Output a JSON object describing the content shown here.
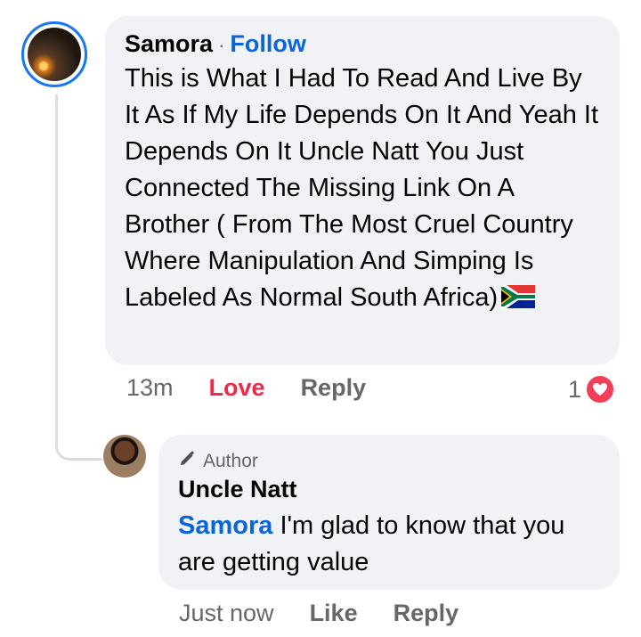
{
  "comment": {
    "author": "Samora",
    "separator": "·",
    "follow_label": "Follow",
    "text": "This is What I Had To Read And Live By It As If My Life Depends On It And Yeah It Depends On It Uncle Natt You Just Connected The Missing Link On A Brother ( From The Most Cruel Country Where Manipulation And Simping Is Labeled As Normal South Africa)",
    "flag_icon": "south-africa-flag-icon",
    "time": "13m",
    "love_label": "Love",
    "reply_label": "Reply",
    "reaction_count": "1",
    "reaction_icon": "heart-icon"
  },
  "reply": {
    "badge_label": "Author",
    "badge_icon": "pencil-icon",
    "author": "Uncle Natt",
    "mention": "Samora",
    "text": "I'm glad to know that you are getting value",
    "time": "Just now",
    "like_label": "Like",
    "reply_label": "Reply"
  },
  "colors": {
    "link_blue": "#0a66d8",
    "love_red": "#f0284a",
    "bubble_gray": "#f0f2f5",
    "avatar_ring": "#1877f2"
  }
}
